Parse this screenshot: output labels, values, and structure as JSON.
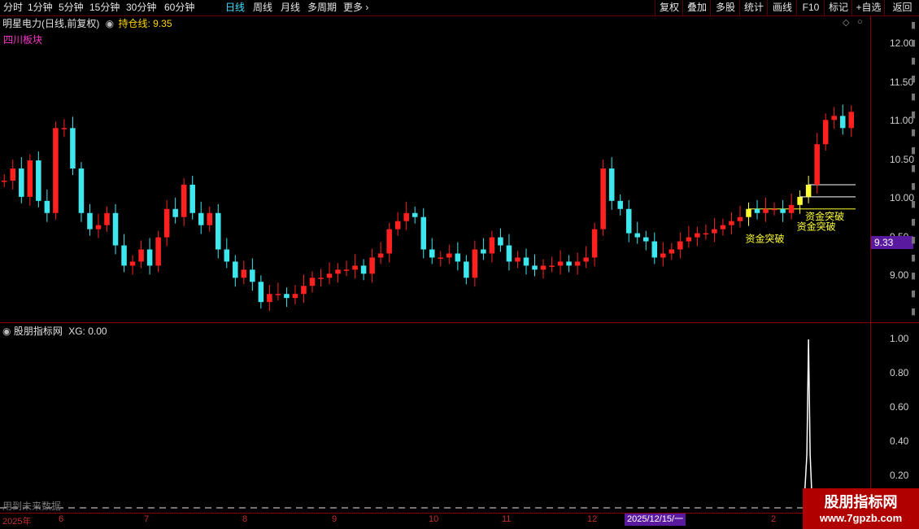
{
  "toolbar": {
    "periods": [
      "分时",
      "1分钟",
      "5分钟",
      "15分钟",
      "30分钟",
      "60分钟",
      "日线",
      "周线",
      "月线",
      "多周期",
      "更多"
    ],
    "active_period": "日线",
    "right_buttons": [
      "复权",
      "叠加",
      "多股",
      "统计",
      "画线",
      "F10",
      "标记",
      "+自选",
      "返回"
    ]
  },
  "chart_header": {
    "stock_title": "明星电力(日线,前复权)",
    "indicator_label": "持仓线: 9.35",
    "sector_tag": "四川板块"
  },
  "price_axis": {
    "labels": [
      "12.00",
      "11.50",
      "11.00",
      "10.50",
      "10.00",
      "9.50",
      "9.00"
    ],
    "min": 8.7,
    "max": 12.3,
    "current_price_badge": "9.33"
  },
  "signals": [
    "资金突破",
    "资金突破",
    "资金突破"
  ],
  "lower_panel": {
    "title": "股朋指标网",
    "value_label": "XG: 0.00",
    "axis_labels": [
      "1.00",
      "0.80",
      "0.60",
      "0.40",
      "0.20"
    ],
    "footer_note": "用到未来数据"
  },
  "time_axis": {
    "labels": [
      "2025年",
      "6",
      "7",
      "8",
      "9",
      "10",
      "11",
      "12",
      "2025/12/15/一",
      "2"
    ]
  },
  "watermark": {
    "title": "股朋指标网",
    "url": "www.7gpzb.com"
  },
  "colors": {
    "up": "#ff2020",
    "down": "#3ee6ee",
    "signal": "#ffff33",
    "grid": "#8a0000",
    "badge": "#5a1aa0"
  },
  "chart_data": {
    "type": "candlestick",
    "y_range": [
      8.7,
      12.3
    ],
    "closes": [
      10.45,
      10.6,
      10.25,
      10.7,
      10.2,
      10.05,
      11.1,
      11.1,
      10.6,
      10.05,
      9.85,
      9.9,
      10.05,
      9.65,
      9.4,
      9.45,
      9.6,
      9.4,
      9.75,
      10.1,
      10.0,
      10.4,
      10.05,
      9.9,
      10.05,
      9.6,
      9.45,
      9.25,
      9.35,
      9.2,
      8.95,
      9.05,
      9.05,
      9.0,
      9.05,
      9.15,
      9.25,
      9.25,
      9.3,
      9.35,
      9.35,
      9.4,
      9.3,
      9.5,
      9.55,
      9.85,
      9.95,
      10.05,
      10.0,
      9.6,
      9.5,
      9.5,
      9.55,
      9.45,
      9.25,
      9.6,
      9.55,
      9.75,
      9.65,
      9.45,
      9.5,
      9.4,
      9.35,
      9.4,
      9.4,
      9.45,
      9.4,
      9.45,
      9.5,
      9.85,
      10.6,
      10.2,
      10.1,
      9.8,
      9.75,
      9.7,
      9.5,
      9.55,
      9.6,
      9.7,
      9.75,
      9.8,
      9.8,
      9.85,
      9.9,
      9.95,
      10.0,
      10.1,
      10.05,
      10.1,
      10.1,
      10.05,
      10.15,
      10.25,
      10.4,
      10.9,
      11.2,
      11.25,
      11.1,
      11.3
    ],
    "signal_indices": [
      87,
      93,
      94
    ]
  }
}
